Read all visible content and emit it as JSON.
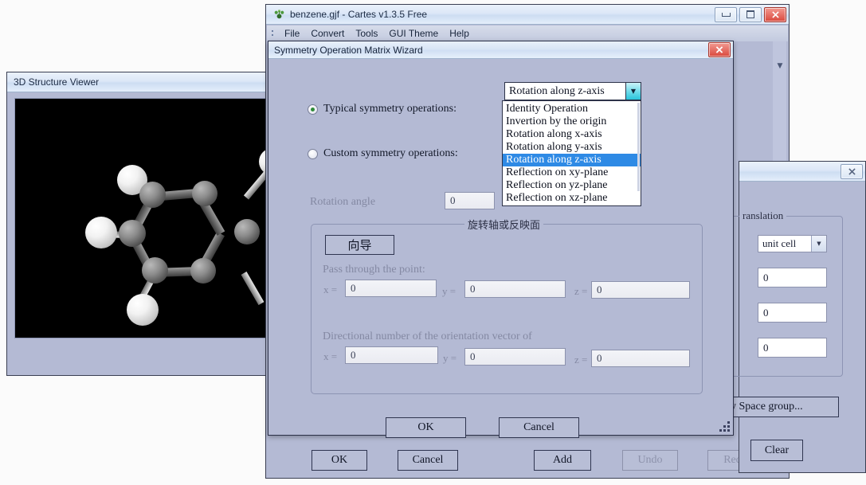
{
  "app_window": {
    "title": "benzene.gjf - Cartes v1.3.5 Free",
    "app_icon": "molecule-icon",
    "titlebar_buttons": [
      {
        "name": "minimize",
        "glyph": "minimize-icon"
      },
      {
        "name": "maximize",
        "glyph": "maximize-icon"
      },
      {
        "name": "close",
        "glyph": "✖"
      }
    ],
    "menu": [
      "File",
      "Convert",
      "Tools",
      "GUI Theme",
      "Help"
    ],
    "scroll_arrow": "▼",
    "bottom_buttons": [
      {
        "label": "OK",
        "disabled": false
      },
      {
        "label": "Cancel",
        "disabled": false
      },
      {
        "label": "Add",
        "disabled": false
      },
      {
        "label": "Undo",
        "disabled": true
      },
      {
        "label": "Redo",
        "disabled": true
      }
    ]
  },
  "viewer_window": {
    "title": "3D Structure Viewer",
    "canvas_background": "#000000",
    "molecule": "benzene",
    "atom_colors": {
      "carbon": "#8c8c8c",
      "hydrogen": "#f2f2f2"
    }
  },
  "wizard": {
    "title": "Symmetry Operation Matrix Wizard",
    "close_glyph": "✖",
    "radios": [
      {
        "label": "Typical symmetry operations:",
        "selected": true
      },
      {
        "label": "Custom symmetry operations:",
        "selected": false
      }
    ],
    "combo": {
      "value": "Rotation along z-axis",
      "arrow": "▼",
      "options": [
        "Identity Operation",
        "Invertion by the origin",
        "Rotation along x-axis",
        "Rotation along y-axis",
        "Rotation along z-axis",
        "Reflection on xy-plane",
        "Reflection on yz-plane",
        "Reflection on xz-plane"
      ],
      "selected_option": "Rotation along z-axis",
      "highlight_color": "#2e8ae5",
      "expanded": true
    },
    "rotation_angle": {
      "label": "Rotation angle",
      "value": "0",
      "disabled": true
    },
    "panel": {
      "title": "旋转轴或反映面",
      "wizard_button": "向导",
      "point_group": {
        "label": "Pass through the point:",
        "fields": [
          {
            "axis": "x =",
            "value": "0"
          },
          {
            "axis": "y =",
            "value": "0"
          },
          {
            "axis": "z =",
            "value": "0"
          }
        ]
      },
      "vector_group": {
        "label": "Directional number of the orientation vector of",
        "fields": [
          {
            "axis": "x =",
            "value": "0"
          },
          {
            "axis": "y =",
            "value": "0"
          },
          {
            "axis": "z =",
            "value": "0"
          }
        ]
      }
    },
    "ok_label": "OK",
    "cancel_label": "Cancel"
  },
  "translation_window": {
    "close_glyph": "✖",
    "group_title": "ranslation",
    "unit_combo": {
      "value": "unit cell",
      "arrow": "▼"
    },
    "fields": [
      {
        "value": "0"
      },
      {
        "value": "0"
      },
      {
        "value": "0"
      }
    ],
    "space_group_button": "by Space group...",
    "clear_button": "Clear"
  }
}
